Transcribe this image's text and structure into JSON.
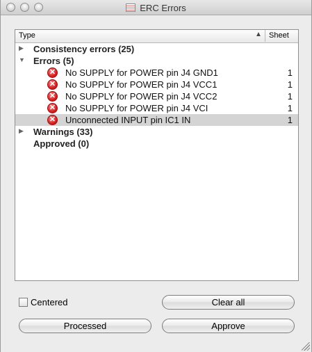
{
  "window": {
    "title": "ERC Errors"
  },
  "table": {
    "columns": {
      "type": "Type",
      "sheet": "Sheet"
    },
    "groups": [
      {
        "label": "Consistency errors (25)",
        "expanded": false
      },
      {
        "label": "Errors (5)",
        "expanded": true,
        "items": [
          {
            "label": "No SUPPLY for POWER pin J4 GND1",
            "sheet": "1"
          },
          {
            "label": "No SUPPLY for POWER pin J4 VCC1",
            "sheet": "1"
          },
          {
            "label": "No SUPPLY for POWER pin J4 VCC2",
            "sheet": "1"
          },
          {
            "label": "No SUPPLY for POWER pin J4 VCI",
            "sheet": "1"
          },
          {
            "label": "Unconnected INPUT pin IC1 IN",
            "sheet": "1",
            "selected": true
          }
        ]
      },
      {
        "label": "Warnings (33)",
        "expanded": false
      },
      {
        "label": "Approved (0)",
        "expandable": false
      }
    ]
  },
  "controls": {
    "centered_label": "Centered",
    "clear_all_label": "Clear all",
    "processed_label": "Processed",
    "approve_label": "Approve"
  },
  "icons": {
    "collapsed": "triangle-right",
    "expanded": "triangle-down",
    "error": "error-circle-x",
    "sort": "triangle-up"
  }
}
